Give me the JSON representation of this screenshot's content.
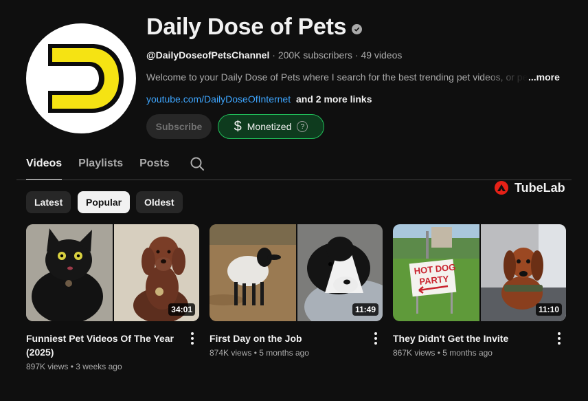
{
  "channel": {
    "title": "Daily Dose of Pets",
    "handle": "@DailyDoseofPetsChannel",
    "subscribers": "200K subscribers",
    "video_count": "49 videos",
    "separator": " · ",
    "description": "Welcome to your Daily Dose of Pets where I search for the best trending pet videos, or pet",
    "description_more": "...more",
    "link": "youtube.com/DailyDoseOfInternet",
    "more_links": "and 2 more links",
    "logo_color": "#f5e313"
  },
  "actions": {
    "subscribe_label": "Subscribe",
    "monetized_label": "Monetized",
    "monetized_icon": "dollar-icon",
    "help_glyph": "?",
    "monetized_color": "#21c05a"
  },
  "tabs": [
    {
      "label": "Videos",
      "active": true
    },
    {
      "label": "Playlists",
      "active": false
    },
    {
      "label": "Posts",
      "active": false
    }
  ],
  "extension": {
    "name": "TubeLab",
    "color": "#e62117"
  },
  "filters": [
    {
      "label": "Latest",
      "active": false
    },
    {
      "label": "Popular",
      "active": true
    },
    {
      "label": "Oldest",
      "active": false
    }
  ],
  "videos": [
    {
      "title": "Funniest Pet Videos Of The Year (2025)",
      "views": "897K views",
      "age": "3 weeks ago",
      "duration": "34:01"
    },
    {
      "title": "First Day on the Job",
      "views": "874K views",
      "age": "5 months ago",
      "duration": "11:49"
    },
    {
      "title": "They Didn't Get the Invite",
      "views": "867K views",
      "age": "5 months ago",
      "duration": "11:10",
      "sign_text_1": "HOT DOG",
      "sign_text_2": "PARTY"
    }
  ],
  "meta_separator": " • "
}
